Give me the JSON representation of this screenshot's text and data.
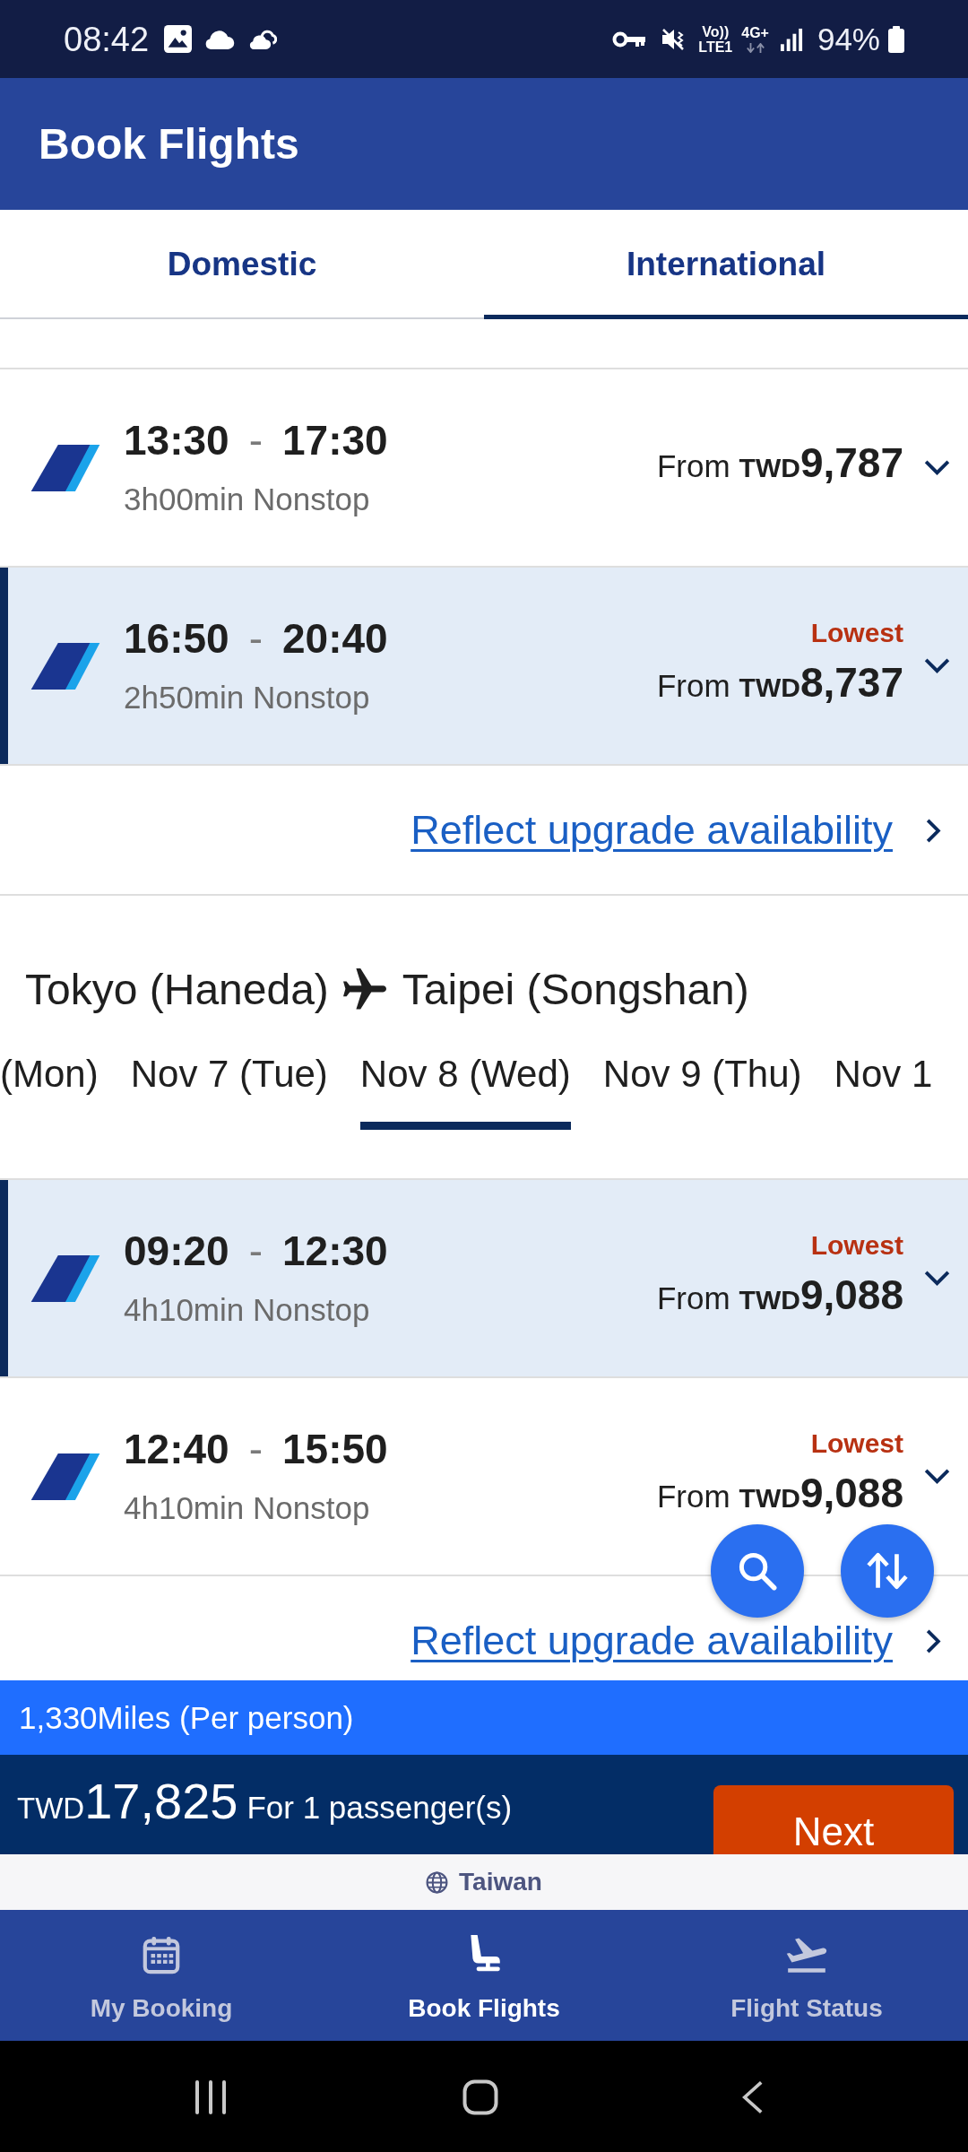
{
  "status_bar": {
    "time": "08:42",
    "volte_top": "Vo))",
    "volte_bottom": "LTE1",
    "network": "4G+",
    "battery": "94%"
  },
  "header": {
    "title": "Book Flights"
  },
  "tabs": [
    {
      "label": "Domestic",
      "selected": false
    },
    {
      "label": "International",
      "selected": true
    }
  ],
  "sections": [
    {
      "flights": [
        {
          "departure": "13:30",
          "separator": "-",
          "arrival": "17:30",
          "duration": "3h00min Nonstop",
          "price_prefix": "From",
          "currency": "TWD",
          "amount": "9,787",
          "selected": false
        },
        {
          "departure": "16:50",
          "separator": "-",
          "arrival": "20:40",
          "duration": "2h50min Nonstop",
          "tag": "Lowest",
          "price_prefix": "From",
          "currency": "TWD",
          "amount": "8,737",
          "selected": true
        }
      ],
      "upgrade_link": "Reflect upgrade availability"
    },
    {
      "route": {
        "origin": "Tokyo (Haneda)",
        "destination": "Taipei (Songshan)"
      },
      "dates": [
        {
          "label": "(Mon)",
          "selected": false
        },
        {
          "label": "Nov 7 (Tue)",
          "selected": false
        },
        {
          "label": "Nov 8 (Wed)",
          "selected": true
        },
        {
          "label": "Nov 9 (Thu)",
          "selected": false
        },
        {
          "label": "Nov 1",
          "selected": false
        }
      ],
      "flights": [
        {
          "departure": "09:20",
          "separator": "-",
          "arrival": "12:30",
          "duration": "4h10min Nonstop",
          "tag": "Lowest",
          "price_prefix": "From",
          "currency": "TWD",
          "amount": "9,088",
          "selected": true
        },
        {
          "departure": "12:40",
          "separator": "-",
          "arrival": "15:50",
          "duration": "4h10min Nonstop",
          "tag": "Lowest",
          "price_prefix": "From",
          "currency": "TWD",
          "amount": "9,088",
          "selected": false
        }
      ],
      "upgrade_link": "Reflect upgrade availability"
    }
  ],
  "summary": {
    "miles": "1,330Miles (Per person)",
    "currency": "TWD",
    "total": "17,825",
    "passengers": "For 1 passenger(s)",
    "next_button": "Next"
  },
  "region": {
    "label": "Taiwan"
  },
  "bottom_nav": [
    {
      "label": "My Booking",
      "selected": false
    },
    {
      "label": "Book Flights",
      "selected": true
    },
    {
      "label": "Flight Status",
      "selected": false
    }
  ]
}
